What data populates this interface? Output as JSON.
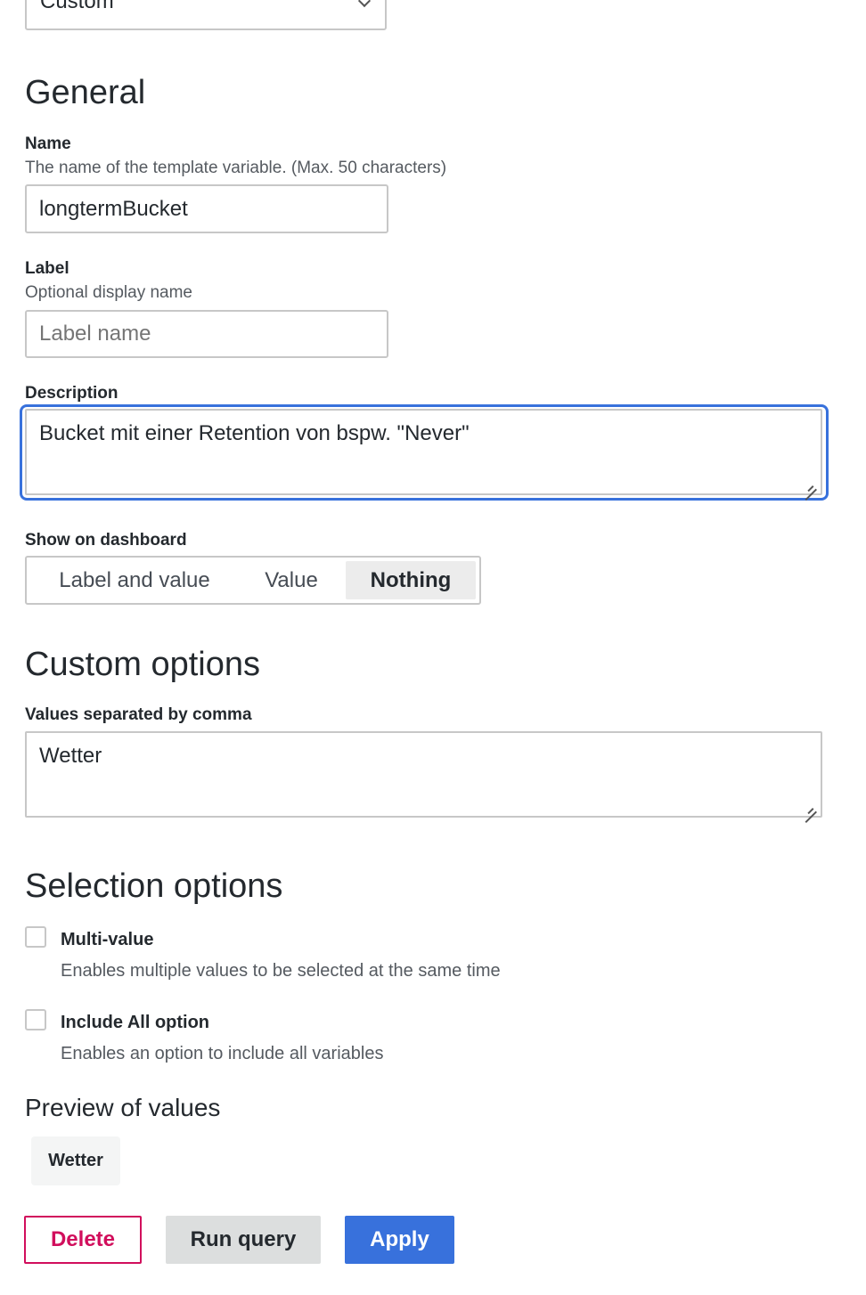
{
  "type_select": {
    "value": "Custom",
    "icon": "chevron-down-icon"
  },
  "general": {
    "heading": "General",
    "name": {
      "label": "Name",
      "description": "The name of the template variable. (Max. 50 characters)",
      "value": "longtermBucket"
    },
    "label": {
      "label": "Label",
      "description": "Optional display name",
      "value": "",
      "placeholder": "Label name"
    },
    "description": {
      "label": "Description",
      "value": "Bucket mit einer Retention von bspw. \"Never\""
    },
    "show_on_dashboard": {
      "label": "Show on dashboard",
      "options": [
        "Label and value",
        "Value",
        "Nothing"
      ],
      "selected": "Nothing"
    }
  },
  "custom_options": {
    "heading": "Custom options",
    "values_label": "Values separated by comma",
    "values": "Wetter"
  },
  "selection_options": {
    "heading": "Selection options",
    "multi_value": {
      "label": "Multi-value",
      "description": "Enables multiple values to be selected at the same time",
      "checked": false
    },
    "include_all": {
      "label": "Include All option",
      "description": "Enables an option to include all variables",
      "checked": false
    }
  },
  "preview": {
    "heading": "Preview of values",
    "values": [
      "Wetter"
    ]
  },
  "actions": {
    "delete": "Delete",
    "run_query": "Run query",
    "apply": "Apply"
  },
  "colors": {
    "primary": "#3871dc",
    "danger": "#d10e5c",
    "secondary_bg": "#dcdede"
  }
}
